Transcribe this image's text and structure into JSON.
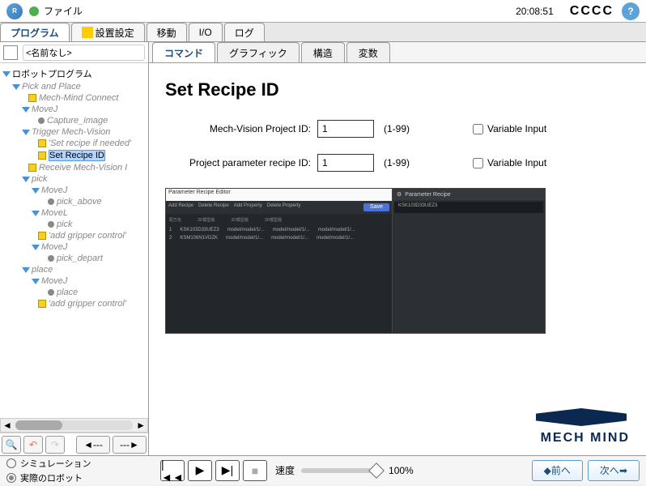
{
  "topbar": {
    "file_label": "ファイル",
    "time": "20:08:51",
    "cccc": "CCCC"
  },
  "main_tabs": [
    "プログラム",
    "設置設定",
    "移動",
    "I/O",
    "ログ"
  ],
  "left": {
    "name_field": "<名前なし>",
    "tree": {
      "root": "ロボットプログラム",
      "pick_place": "Pick and Place",
      "mech_connect": "Mech-Mind Connect",
      "movej1": "MoveJ",
      "capture": "Capture_image",
      "trigger": "Trigger Mech-Vision",
      "set_recipe_note": "'Set recipe if needed'",
      "set_recipe_id": "Set Recipe ID",
      "receive": "Receive Mech-Vision I",
      "pick": "pick",
      "movej2": "MoveJ",
      "pick_above": "pick_above",
      "movel1": "MoveL",
      "pick_point": "pick",
      "add_gripper1": "'add gripper control'",
      "movej3": "MoveJ",
      "pick_depart": "pick_depart",
      "place": "place",
      "movej4": "MoveJ",
      "place_point": "place",
      "add_gripper2": "'add gripper control'"
    }
  },
  "sub_tabs": [
    "コマンド",
    "グラフィック",
    "構造",
    "変数"
  ],
  "content": {
    "title": "Set Recipe ID",
    "project_id_label": "Mech-Vision Project ID:",
    "project_id_value": "1",
    "range": "(1-99)",
    "recipe_id_label": "Project parameter recipe ID:",
    "recipe_id_value": "1",
    "variable_input": "Variable Input",
    "logo_text": "MECH MIND"
  },
  "preview": {
    "title": "Parameter Recipe Editor",
    "toolbar": [
      "Add Recipe",
      "Delete Recipe",
      "Add Property",
      "Delete Property"
    ],
    "save": "Save",
    "row1_name": "KSK103D33UEZ3",
    "row1_model": "model/model/1/...",
    "row2_name": "KSM106N1VDZK",
    "row2_model": "model/model/1/...",
    "right_title": "Parameter Recipe",
    "right_item": "KSK103D33UEZ3"
  },
  "bottom": {
    "simulation": "シミュレーション",
    "real_robot": "実際のロボット",
    "speed_label": "速度",
    "speed_value": "100%",
    "prev": "前へ",
    "next": "次へ"
  }
}
